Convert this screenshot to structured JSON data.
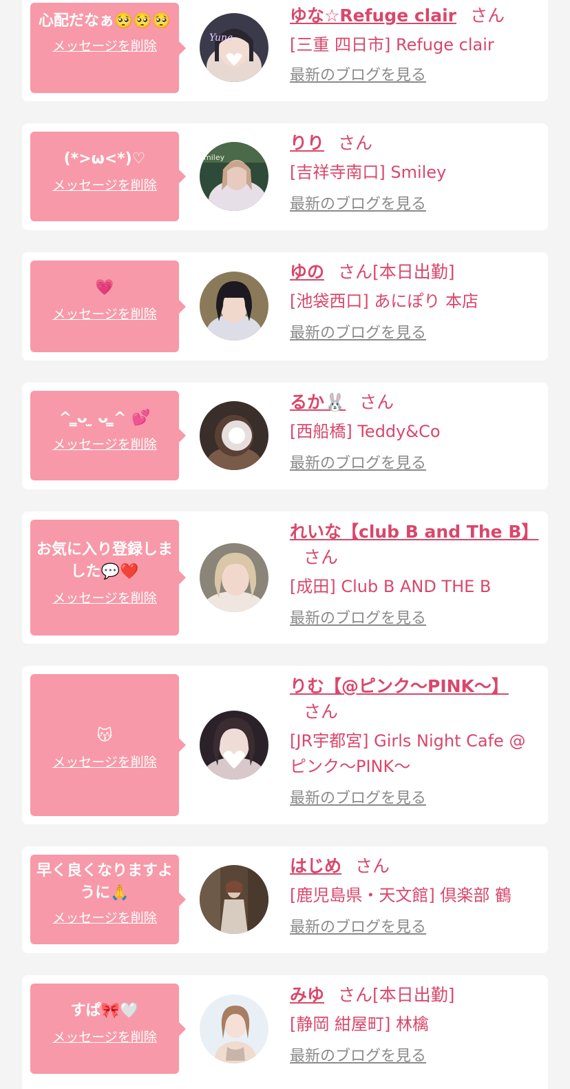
{
  "delete_label": "メッセージを削除",
  "blog_label": "最新のブログを見る",
  "suffix": "さん",
  "colors": {
    "bubble": "#f799a8",
    "accent": "#d9476b",
    "link_gray": "#8a8a8a",
    "background": "#f4f4f4"
  },
  "entries": [
    {
      "message": "心配だなぁ🥺🥺🥺",
      "name": "ゆな☆Refuge clair",
      "status": "",
      "shop": "[三重 四日市] Refuge clair"
    },
    {
      "message": "(*>ω<*)♡",
      "name": "りり",
      "status": "",
      "shop": "[吉祥寺南口] Smiley"
    },
    {
      "message": "💗",
      "name": "ゆの",
      "status": "[本日出勤]",
      "shop": "[池袋西口] あにぽり 本店"
    },
    {
      "message": "^ ̳ᴗ ̫ ᴗ ̳^ 💕",
      "name": "るか🐰",
      "status": "",
      "shop": "[西船橋] Teddy&Co"
    },
    {
      "message": "お気に入り登録しました💬❤️",
      "name": "れいな【club B and The B】",
      "status": "",
      "shop": "[成田] Club B AND THE B"
    },
    {
      "message": "😽",
      "name": "りむ【@ピンク〜PINK〜】",
      "status": "",
      "shop": "[JR宇都宮] Girls Night Cafe @ピンク〜PINK〜"
    },
    {
      "message": "早く良くなりますように🙏",
      "name": "はじめ",
      "status": "",
      "shop": "[鹿児島県・天文館] 倶楽部 鶴"
    },
    {
      "message": "すぱ🎀🤍",
      "name": "みゆ",
      "status": "[本日出勤]",
      "shop": "[静岡 紺屋町] 林檎"
    }
  ]
}
